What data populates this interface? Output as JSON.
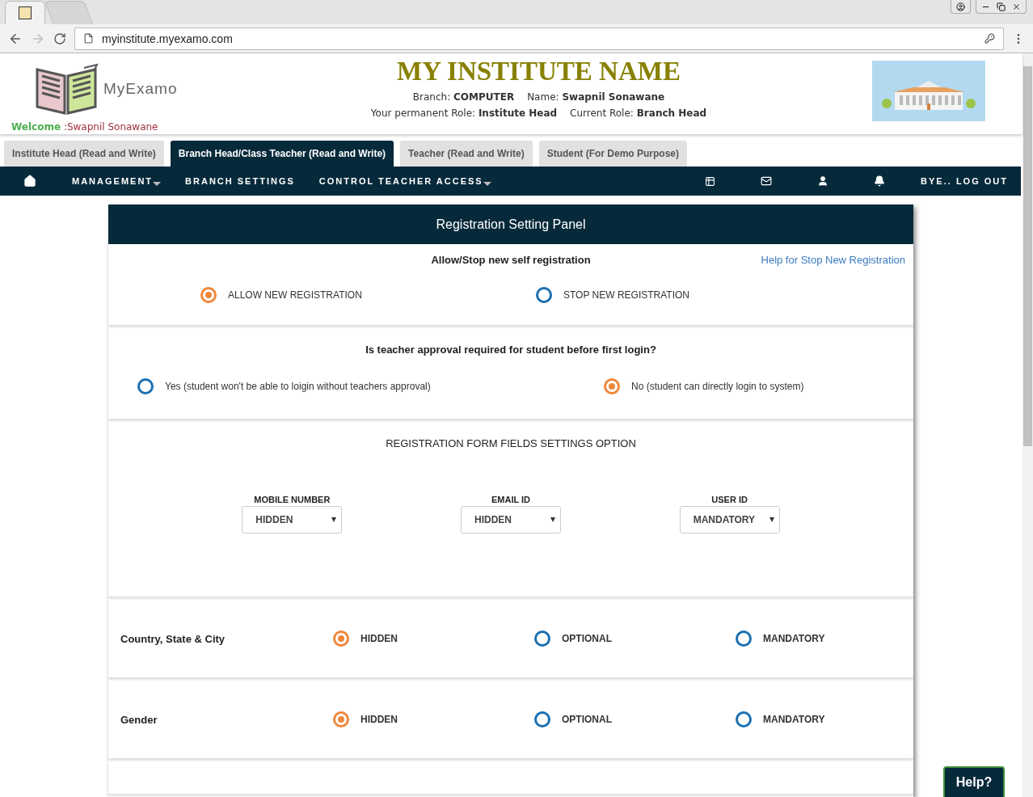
{
  "browser": {
    "url": "myinstitute.myexamo.com"
  },
  "header": {
    "logo_text": "MyExamo",
    "title": "MY INSTITUTE NAME",
    "info_lines": [
      [
        {
          "label": "Branch:",
          "value": "COMPUTER"
        },
        {
          "label": "Name:",
          "value": "Swapnil Sonawane"
        }
      ],
      [
        {
          "label": "Your permanent Role:",
          "value": "Institute Head"
        },
        {
          "label": "Current Role:",
          "value": "Branch Head"
        }
      ]
    ],
    "welcome_label": "Welcome",
    "welcome_name": ":Swapnil Sonawane"
  },
  "role_tabs": [
    {
      "label": "Institute Head (Read and Write)",
      "selected": false
    },
    {
      "label": "Branch Head/Class Teacher (Read and Write)",
      "selected": true
    },
    {
      "label": "Teacher (Read and Write)",
      "selected": false
    },
    {
      "label": "Student (For Demo Purpose)",
      "selected": false
    }
  ],
  "nav": {
    "items": [
      {
        "label": "MANAGEMENT",
        "dropdown": true
      },
      {
        "label": "BRANCH SETTINGS",
        "dropdown": false
      },
      {
        "label": "CONTROL TEACHER ACCESS",
        "dropdown": true
      }
    ],
    "logout": "BYE.. LOG OUT"
  },
  "panel": {
    "title": "Registration Setting Panel",
    "self_registration": {
      "title": "Allow/Stop new self registration",
      "help_link": "Help for Stop New Registration",
      "options": [
        {
          "label": "ALLOW NEW REGISTRATION",
          "selected": true
        },
        {
          "label": "STOP NEW REGISTRATION",
          "selected": false
        }
      ]
    },
    "teacher_approval": {
      "title": "Is teacher approval required for student before first login?",
      "options": [
        {
          "label": "Yes (student won't be able to loigin without teachers approval)",
          "selected": false
        },
        {
          "label": "No (student can directly login to system)",
          "selected": true
        }
      ]
    },
    "form_fields": {
      "title": "REGISTRATION FORM FIELDS SETTINGS OPTION",
      "selects": [
        {
          "label": "MOBILE NUMBER",
          "value": "HIDDEN"
        },
        {
          "label": "EMAIL ID",
          "value": "HIDDEN"
        },
        {
          "label": "USER ID",
          "value": "MANDATORY"
        }
      ]
    },
    "field_rows": [
      {
        "label": "Country, State & City",
        "options": [
          {
            "label": "HIDDEN",
            "selected": true
          },
          {
            "label": "OPTIONAL",
            "selected": false
          },
          {
            "label": "MANDATORY",
            "selected": false
          }
        ]
      },
      {
        "label": "Gender",
        "options": [
          {
            "label": "HIDDEN",
            "selected": true
          },
          {
            "label": "OPTIONAL",
            "selected": false
          },
          {
            "label": "MANDATORY",
            "selected": false
          }
        ]
      }
    ]
  },
  "help_button": "Help?"
}
